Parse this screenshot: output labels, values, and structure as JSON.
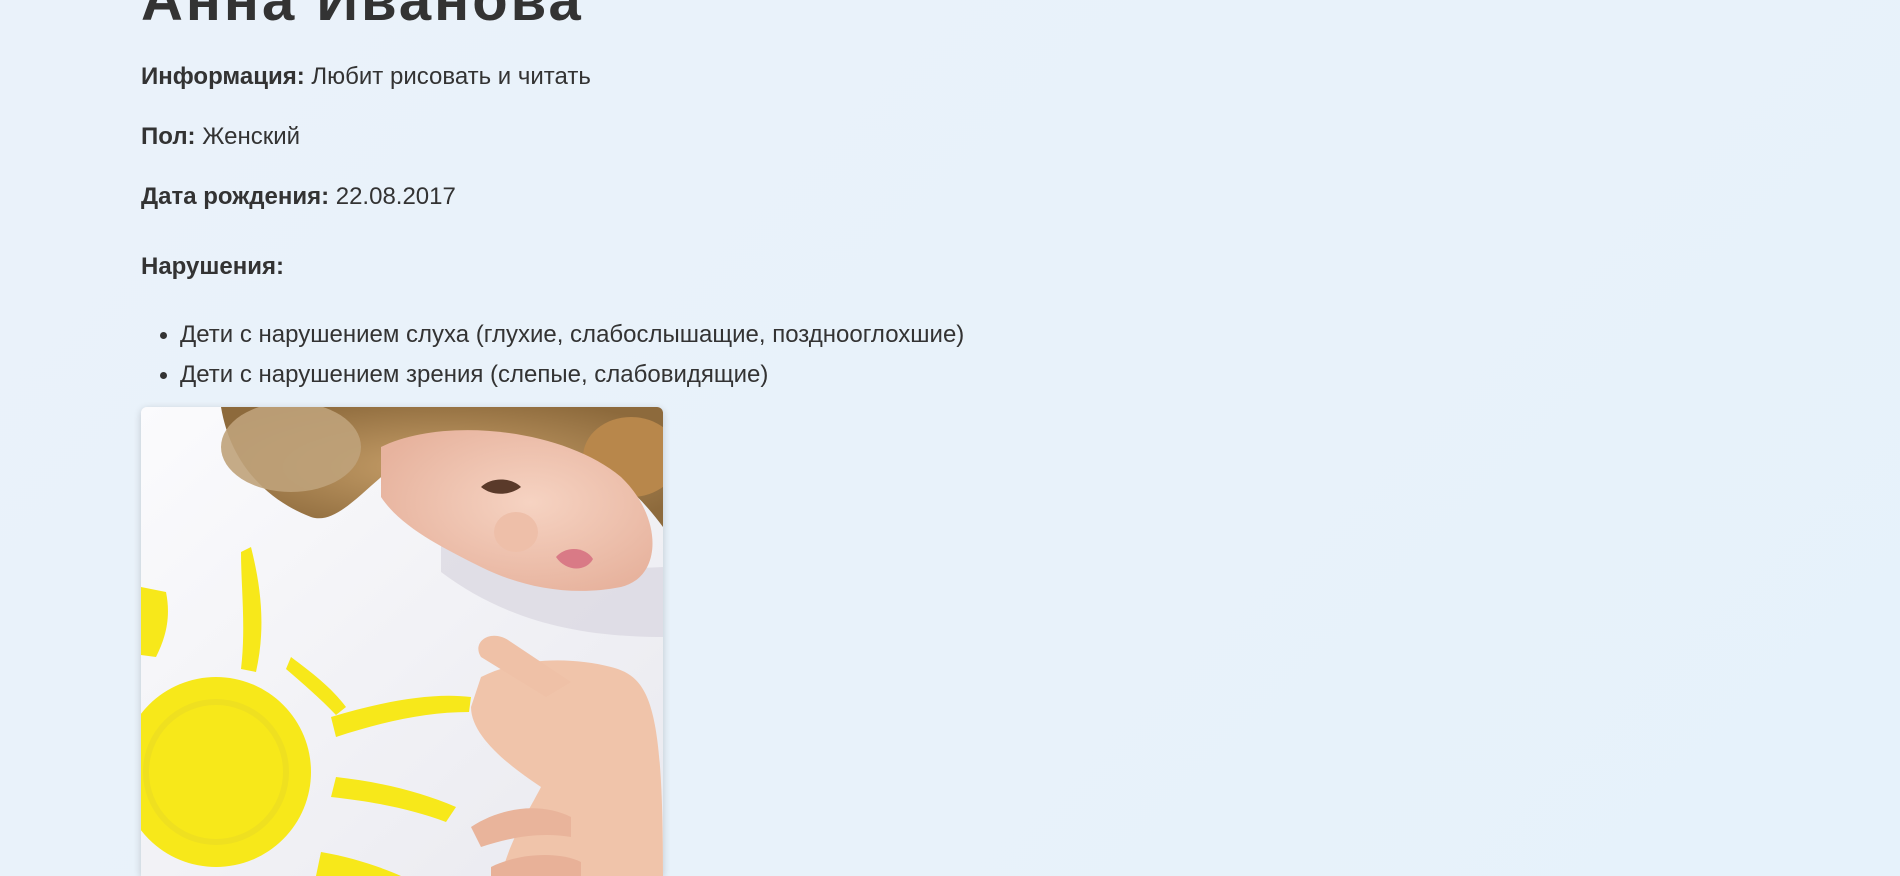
{
  "profile": {
    "name": "Анна Иванова",
    "info_label": "Информация:",
    "info_value": "Любит рисовать и читать",
    "gender_label": "Пол:",
    "gender_value": "Женский",
    "dob_label": "Дата рождения:",
    "dob_value": "22.08.2017",
    "disorders_title": "Нарушения:",
    "disorders": [
      "Дети с нарушением слуха (глухие, слабослышащие, позднооглохшие)",
      "Дети с нарушением зрения (слепые, слабовидящие)"
    ],
    "photo_icon": "child-painting-sun-photo"
  },
  "colors": {
    "text": "#333333",
    "background": "#e8f2fa",
    "sun_yellow": "#f7e81a"
  }
}
